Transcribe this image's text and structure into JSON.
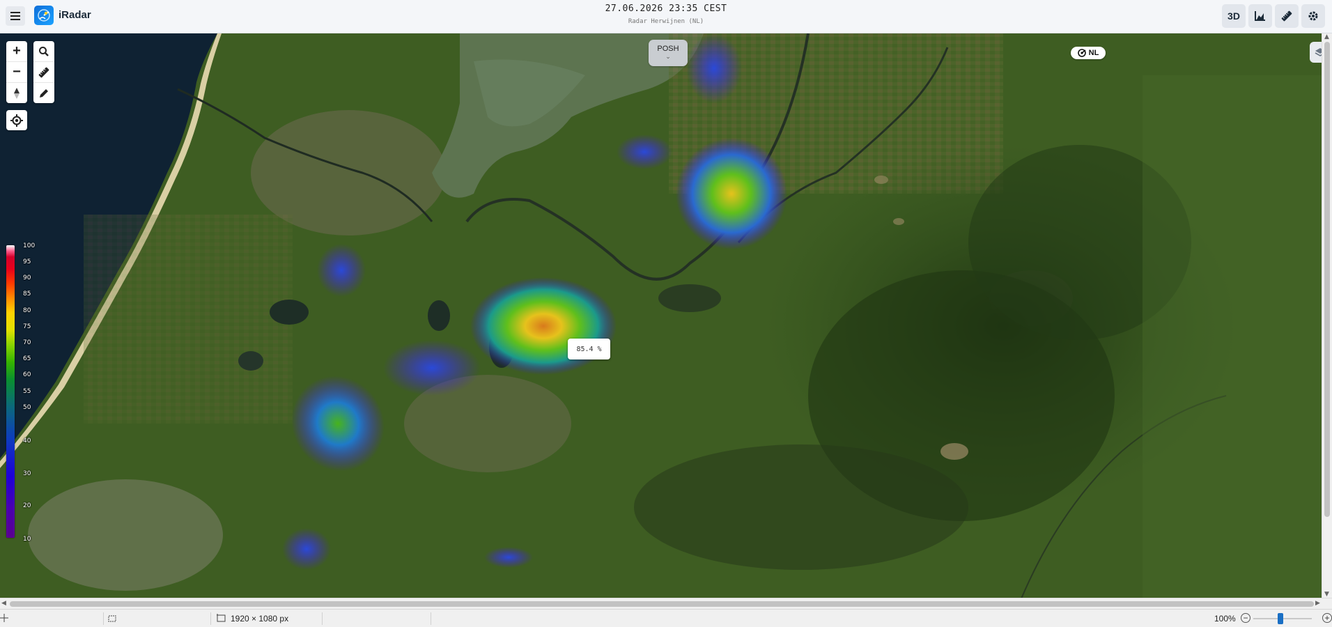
{
  "header": {
    "app_name": "iRadar",
    "datetime": "27.06.2026 23:35 CEST",
    "radar_station": "Radar Herwijnen (NL)",
    "buttons": [
      {
        "name": "3d-button",
        "label": "3D"
      },
      {
        "name": "chart-button",
        "label": "",
        "icon": "area-chart-icon"
      },
      {
        "name": "ruler-button",
        "label": "",
        "icon": "ruler-icon"
      },
      {
        "name": "settings-button",
        "label": "",
        "icon": "gear-icon"
      }
    ]
  },
  "map_controls": {
    "zoom_in": "+",
    "zoom_out": "−",
    "tools": [
      "search-icon",
      "ruler-icon",
      "pencil-icon"
    ],
    "north": "compass-icon",
    "locate": "locate-icon"
  },
  "product_selector": {
    "label": "POSH",
    "chevron": "⌄"
  },
  "country_badge": {
    "label": "NL"
  },
  "legend": {
    "labels": [
      "100",
      "95",
      "90",
      "85",
      "80",
      "75",
      "70",
      "65",
      "60",
      "55",
      "50",
      "40",
      "30",
      "20",
      "10"
    ],
    "unit": "%"
  },
  "tooltip": {
    "value": "85.4 %"
  },
  "statusbar": {
    "dimensions": "1920 × 1080 px",
    "zoom": "100%",
    "zoom_level": 0.5
  },
  "colors": {
    "accent": "#1a6fc4",
    "topbar": "#f4f6f9"
  }
}
